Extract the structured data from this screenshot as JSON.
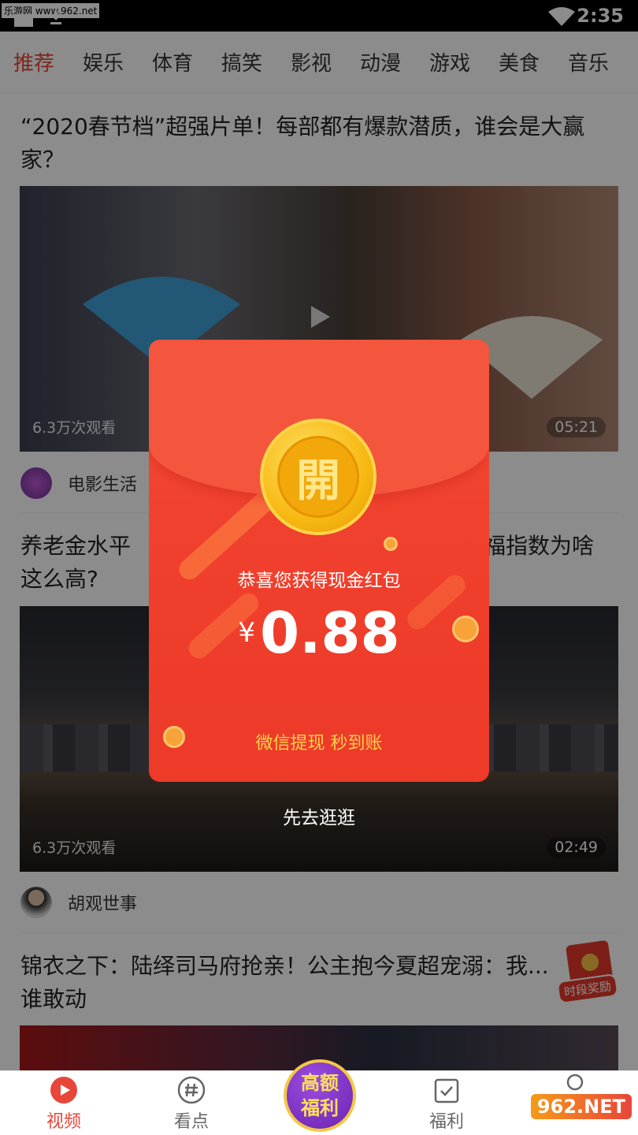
{
  "status_bar": {
    "watermark": "乐游网 www.962.net",
    "time": "2:35"
  },
  "tabs": [
    "推荐",
    "娱乐",
    "体育",
    "搞笑",
    "影视",
    "动漫",
    "游戏",
    "美食",
    "音乐"
  ],
  "active_tab": 0,
  "feed": [
    {
      "title": "“2020春节档”超强片单！每部都有爆款潜质，谁会是大赢家？",
      "views": "6.3万次观看",
      "duration": "05:21",
      "author": "电影生活"
    },
    {
      "title_left": "养老金水平",
      "title_right": "幸福指数为啥",
      "title_line2": "这么高?",
      "views": "6.3万次观看",
      "duration": "02:49",
      "author": "胡观世事"
    },
    {
      "title": "锦衣之下：陆绎司马府抢亲！公主抱今夏超宠溺：我...谁敢动"
    }
  ],
  "red_packet": {
    "coin_char": "開",
    "message": "恭喜您获得现金红包",
    "currency": "¥",
    "amount": "0.88",
    "footer": "微信提现 秒到账",
    "dismiss": "先去逛逛"
  },
  "reward_badge": "时段奖励",
  "bottom_nav": {
    "items": [
      "视频",
      "看点",
      "福利"
    ],
    "welfare_line1": "高额",
    "welfare_line2": "福利",
    "watermark": "962.NET"
  },
  "colors": {
    "accent": "#e8463a",
    "packet": "#f0402e",
    "coin": "#f7b912",
    "gold_text": "#ffd24a"
  }
}
